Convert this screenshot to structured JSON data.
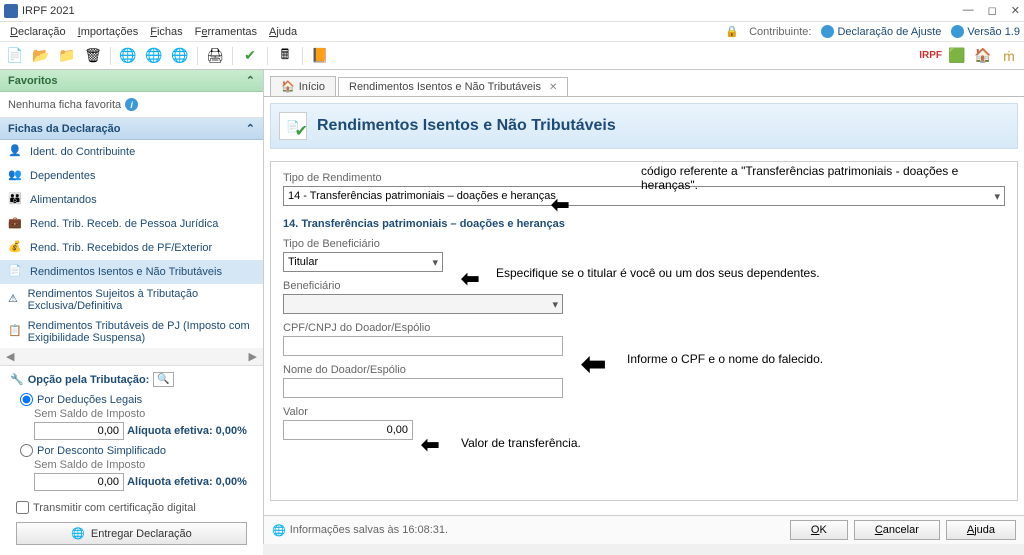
{
  "window": {
    "title": "IRPF 2021"
  },
  "menu": {
    "items": [
      "Declaração",
      "Importações",
      "Fichas",
      "Ferramentas",
      "Ajuda"
    ],
    "contribuinte": "Contribuinte:",
    "decl_ajuste": "Declaração de Ajuste",
    "versao": "Versão 1.9"
  },
  "sidebar": {
    "fav_header": "Favoritos",
    "fav_empty": "Nenhuma ficha favorita",
    "fichas_header": "Fichas da Declaração",
    "fichas": [
      "Ident. do Contribuinte",
      "Dependentes",
      "Alimentandos",
      "Rend. Trib. Receb. de Pessoa Jurídica",
      "Rend. Trib. Recebidos de PF/Exterior",
      "Rendimentos Isentos e Não Tributáveis",
      "Rendimentos Sujeitos à Tributação Exclusiva/Definitiva",
      "Rendimentos Tributáveis de PJ (Imposto com Exigibilidade Suspensa)"
    ],
    "opcao_title": "Opção pela Tributação:",
    "opt1": "Por Deduções Legais",
    "opt2": "Por Desconto Simplificado",
    "sem_saldo": "Sem Saldo de Imposto",
    "zero": "0,00",
    "aliq": "Alíquota efetiva: 0,00%",
    "cert": "Transmitir com certificação digital",
    "entregar": "Entregar Declaração"
  },
  "tabs": {
    "inicio": "Início",
    "rend": "Rendimentos Isentos e Não Tributáveis"
  },
  "page": {
    "title": "Rendimentos Isentos e Não Tributáveis"
  },
  "form": {
    "tipo_rend_label": "Tipo de Rendimento",
    "tipo_rend_value": "14 - Transferências patrimoniais – doações e heranças",
    "section": "Transferências patrimoniais – doações e heranças",
    "section_num": "14.",
    "tipo_ben_label": "Tipo de Beneficiário",
    "tipo_ben_value": "Titular",
    "beneficiario_label": "Beneficiário",
    "cpf_label": "CPF/CNPJ do Doador/Espólio",
    "nome_label": "Nome do Doador/Espólio",
    "valor_label": "Valor",
    "valor_value": "0,00"
  },
  "annotations": {
    "a1": "código referente a \"Transferências patrimoniais - doações e heranças\".",
    "a2": "Especifique se o titular é você ou um dos seus dependentes.",
    "a3": "Informe o CPF e o nome do falecido.",
    "a4": "Valor de transferência."
  },
  "footer": {
    "saved": "Informações salvas às 16:08:31.",
    "ok": "OK",
    "cancel": "Cancelar",
    "help": "Ajuda"
  }
}
